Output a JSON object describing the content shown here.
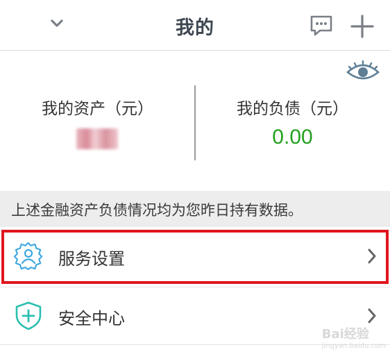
{
  "header": {
    "title": "我的",
    "icons": [
      "chevron-down-icon",
      "message-icon",
      "plus-icon"
    ]
  },
  "assets": {
    "visibility_icon": "eye-icon",
    "assets_label": "我的资产（元）",
    "debt_label": "我的负债（元）",
    "debt_value": "0.00",
    "debt_color": "#23a01e"
  },
  "notice": {
    "text": "上述金融资产负债情况均为您昨日持有数据。"
  },
  "menu": {
    "items": [
      {
        "label": "服务设置",
        "icon": "gear-user-icon"
      },
      {
        "label": "安全中心",
        "icon": "shield-plus-icon"
      }
    ]
  },
  "highlight_color": "#e0161e",
  "watermark": {
    "text": "Bai经验",
    "sub": "jingyan.baidu.com"
  }
}
